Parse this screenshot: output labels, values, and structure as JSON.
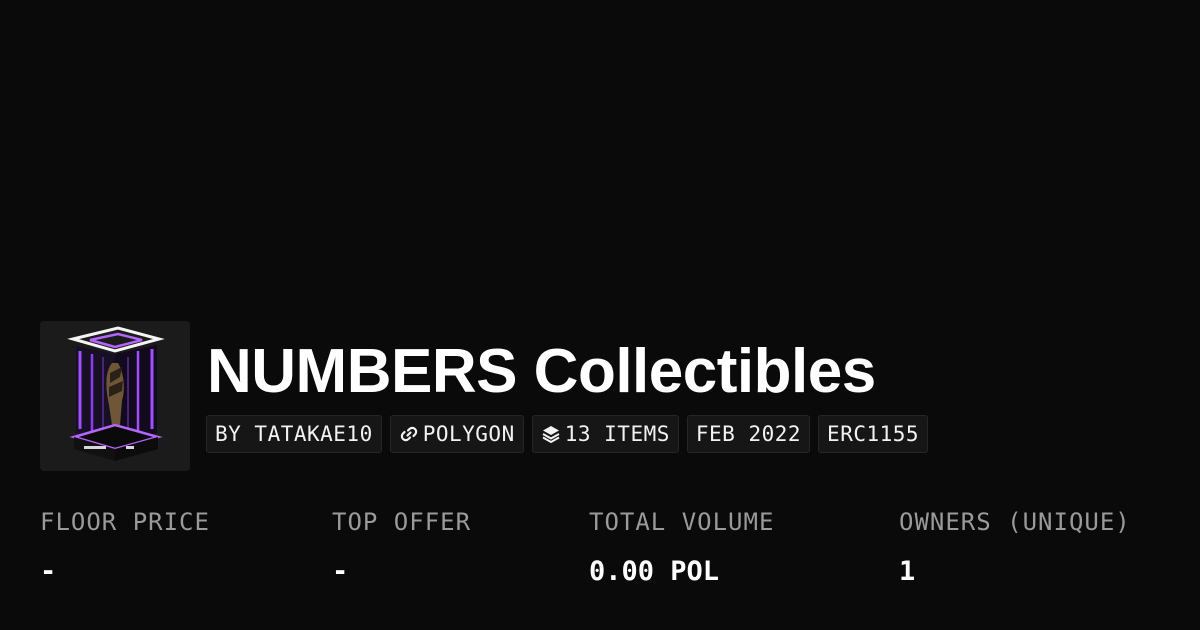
{
  "collection": {
    "title": "NUMBERS Collectibles",
    "image_icon": "collection-thumbnail-glowing-display-case",
    "accent_color": "#a24dff"
  },
  "tags": {
    "creator": "BY TATAKAE10",
    "chain": "POLYGON",
    "chain_icon": "link-icon",
    "items": "13 ITEMS",
    "items_icon": "layers-icon",
    "date": "FEB 2022",
    "standard": "ERC1155"
  },
  "stats": {
    "floor_price": {
      "label": "FLOOR PRICE",
      "value": "-"
    },
    "top_offer": {
      "label": "TOP OFFER",
      "value": "-"
    },
    "total_volume": {
      "label": "TOTAL VOLUME",
      "value": "0.00 POL"
    },
    "owners": {
      "label": "OWNERS (UNIQUE)",
      "value": "1"
    }
  }
}
